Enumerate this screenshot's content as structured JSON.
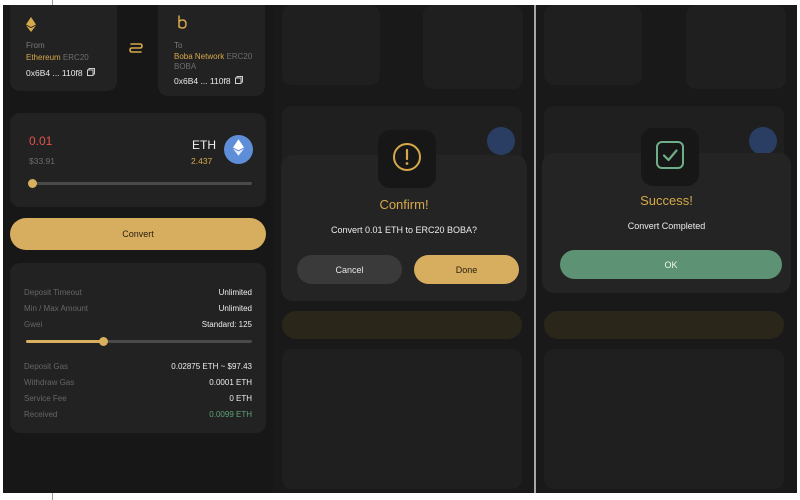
{
  "bridge": {
    "from": {
      "label": "From",
      "network": "Ethereum",
      "token_type": "ERC20",
      "address": "0x6B4 ... 110f8"
    },
    "to": {
      "label": "To",
      "network": "Boba Network",
      "token_type": "ERC20",
      "token_type_line2": "BOBA",
      "address": "0x6B4 ... 110f8"
    },
    "amount": {
      "value": "0.01",
      "usd": "$33.91",
      "symbol": "ETH",
      "balance": "2.437",
      "slider_fraction": 0.004
    },
    "convert_label": "Convert",
    "details": [
      {
        "key": "Deposit Timeout",
        "value": "Unlimited"
      },
      {
        "key": "Min / Max Amount",
        "value": "Unlimited"
      },
      {
        "key": "Gwei",
        "value": "Standard: 125"
      }
    ],
    "gwei_slider_fraction": 0.34,
    "fees": [
      {
        "key": "Deposit Gas",
        "value": "0.02875 ETH ~ $97.43"
      },
      {
        "key": "Withdraw Gas",
        "value": "0.0001 ETH"
      },
      {
        "key": "Service Fee",
        "value": "0 ETH"
      },
      {
        "key": "Received",
        "value": "0.0099 ETH"
      }
    ]
  },
  "confirm_dialog": {
    "title": "Confirm!",
    "message": "Convert 0.01 ETH to ERC20 BOBA?",
    "cancel_label": "Cancel",
    "done_label": "Done",
    "icon": "exclamation-circle-icon"
  },
  "success_dialog": {
    "title": "Success!",
    "message": "Convert Completed",
    "ok_label": "OK",
    "icon": "check-square-icon"
  },
  "colors": {
    "accent_gold": "#d7ad5f",
    "success_green": "#5e9275",
    "amount_red": "#e0544b",
    "eth_blue": "#5f8ed9"
  }
}
